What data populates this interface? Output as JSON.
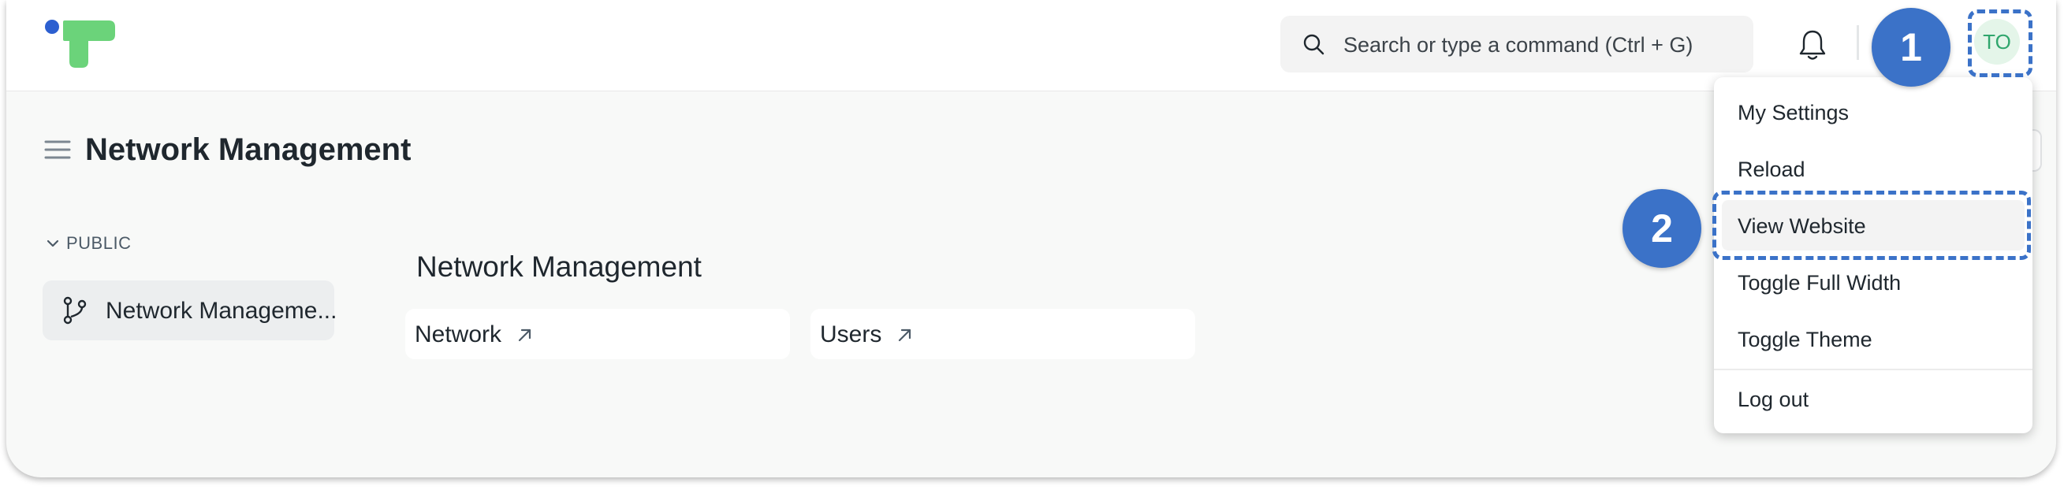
{
  "navbar": {
    "search_placeholder": "Search or type a command (Ctrl + G)",
    "avatar_initials": "TO"
  },
  "page": {
    "title": "Network Management"
  },
  "sidebar": {
    "section_label": "PUBLIC",
    "items": [
      {
        "label": "Network Manageme..."
      }
    ]
  },
  "main": {
    "section_title": "Network Management",
    "cards": [
      {
        "label": "Network"
      },
      {
        "label": "Users"
      }
    ]
  },
  "user_menu": {
    "items": [
      {
        "label": "My Settings"
      },
      {
        "label": "Reload"
      },
      {
        "label": "View Website"
      },
      {
        "label": "Toggle Full Width"
      },
      {
        "label": "Toggle Theme"
      },
      {
        "label": "Log out"
      }
    ]
  },
  "callouts": [
    {
      "number": "1"
    },
    {
      "number": "2"
    }
  ],
  "colors": {
    "accent": "#3b72c8",
    "logo_blue": "#2c5fd0",
    "logo_green": "#6bd37a",
    "avatar_bg": "#e4f5e9",
    "avatar_text": "#30a66d"
  }
}
